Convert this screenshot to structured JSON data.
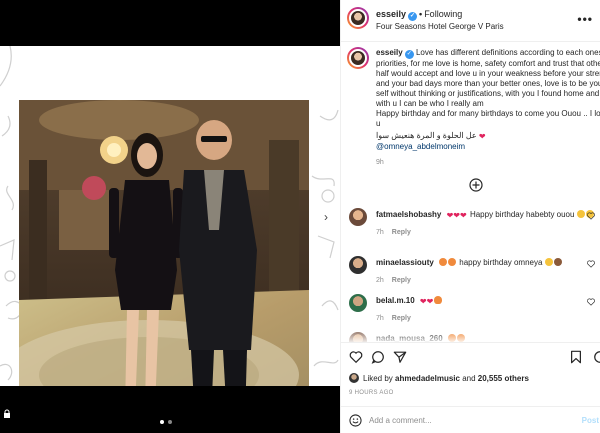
{
  "post": {
    "username": "esseily",
    "separator": "•",
    "follow_state": "Following",
    "location": "Four Seasons Hotel George V Paris",
    "more": "•••"
  },
  "caption": {
    "username": "esseily",
    "lines": [
      "Love has different definitions according to each ones",
      "priorities, for me love is home, safety comfort and trust that other",
      "half would accept and love u in your weakness before your strength",
      "and your bad days more than your better ones, love is to be your",
      "self without thinking or justifications, with you I found home and",
      "with u I can be who I really am",
      "Happy birthday and for many birthdays to come you Ouou .. I love",
      "u"
    ],
    "arabic": "عل الحلوة و المرة هنعيش سوا",
    "mention": "@omneya_abdelmoneim",
    "time": "9h"
  },
  "comments": [
    {
      "username": "fatmaelshobashy",
      "text": "Happy birthday habebty ouou",
      "time": "7h",
      "reply": "Reply",
      "avatar": "#6b4a3a"
    },
    {
      "username": "minaelassiouty",
      "text": "happy birthday omneya",
      "time": "2h",
      "reply": "Reply",
      "avatar": "#2f2f2f"
    },
    {
      "username": "belal.m.10",
      "text": "",
      "time": "7h",
      "reply": "Reply",
      "avatar": "#2e6e4a"
    },
    {
      "username": "nada_mousa_260",
      "text": "",
      "time": "",
      "reply": "",
      "avatar": "#8a6a5a"
    }
  ],
  "likes": {
    "prefix": "Liked by",
    "user": "ahmedadelmusic",
    "and": "and",
    "count": "20,555 others"
  },
  "post_time": "9 HOURS AGO",
  "add_comment": {
    "placeholder": "Add a comment...",
    "post_label": "Post"
  },
  "colors": {
    "verified": "#3897f0",
    "heart": "#e0245e",
    "mention": "#00376b"
  }
}
